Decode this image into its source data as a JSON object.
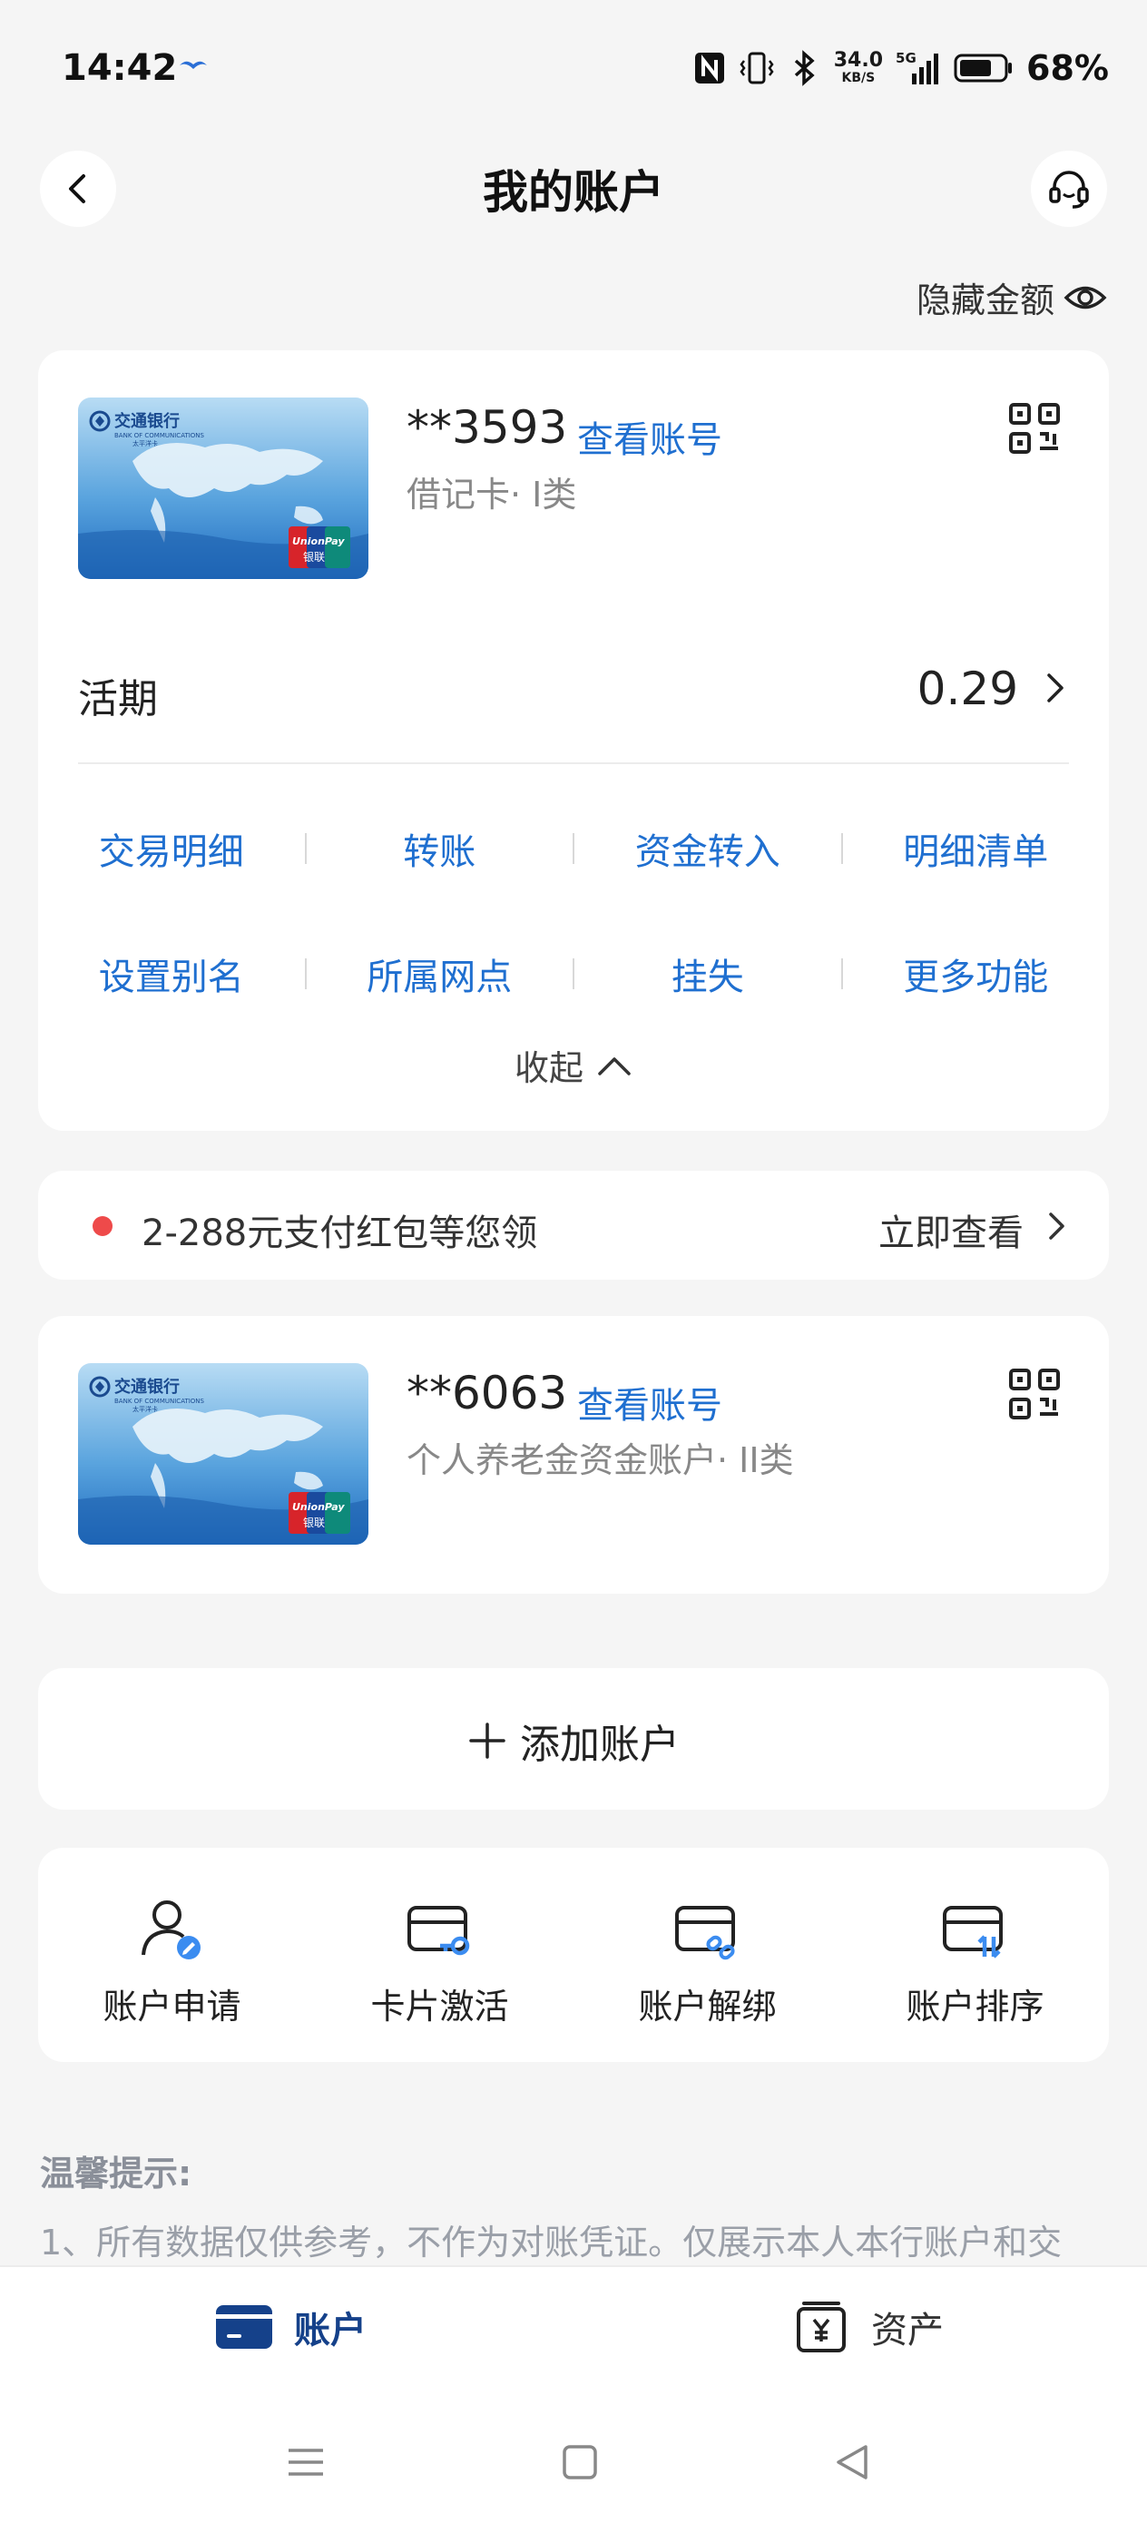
{
  "status_bar": {
    "time": "14:42",
    "net_speed_value": "34.0",
    "net_speed_unit": "KB/S",
    "signal_label": "5G",
    "battery_percent": "68%",
    "icons": [
      "bird-notification-icon",
      "nfc-icon",
      "vibrate-icon",
      "bluetooth-icon",
      "signal-icon",
      "battery-icon"
    ]
  },
  "header": {
    "title": "我的账户",
    "back_icon": "chevron-left-icon",
    "service_icon": "headset-icon"
  },
  "hide_amount": {
    "label": "隐藏金额",
    "icon": "eye-icon"
  },
  "accounts": [
    {
      "masked_number": "**3593",
      "view_label": "查看账号",
      "type_label": "借记卡· I类",
      "balance_label": "活期",
      "balance_value": "0.29",
      "functions": [
        [
          "交易明细",
          "转账",
          "资金转入",
          "明细清单"
        ],
        [
          "设置别名",
          "所属网点",
          "挂失",
          "更多功能"
        ]
      ],
      "collapse_label": "收起"
    },
    {
      "masked_number": "**6063",
      "view_label": "查看账号",
      "type_label": "个人养老金资金账户· II类"
    }
  ],
  "bank_card": {
    "bank_name": "交通银行",
    "bank_name_en": "BANK OF COMMUNICATIONS",
    "sub_label": "太平洋卡",
    "unionpay_label": "UnionPay",
    "unionpay_cn": "银联"
  },
  "promo": {
    "text": "2-288元支付红包等您领",
    "action": "立即查看"
  },
  "add_account": {
    "label": "添加账户"
  },
  "quick_actions": [
    {
      "label": "账户申请",
      "icon": "user-edit-icon"
    },
    {
      "label": "卡片激活",
      "icon": "card-key-icon"
    },
    {
      "label": "账户解绑",
      "icon": "card-unlink-icon"
    },
    {
      "label": "账户排序",
      "icon": "card-sort-icon"
    }
  ],
  "tips": {
    "title": "温馨提示:",
    "line1": "1、所有数据仅供参考，不作为对账凭证。仅展示本人本行账户和交"
  },
  "tab_bar": {
    "account": "账户",
    "assets": "资产"
  },
  "colors": {
    "accent_blue": "#1f6fd0",
    "tab_active": "#15418a",
    "background": "#f5f5f5",
    "promo_dot": "#ee4a4a"
  }
}
